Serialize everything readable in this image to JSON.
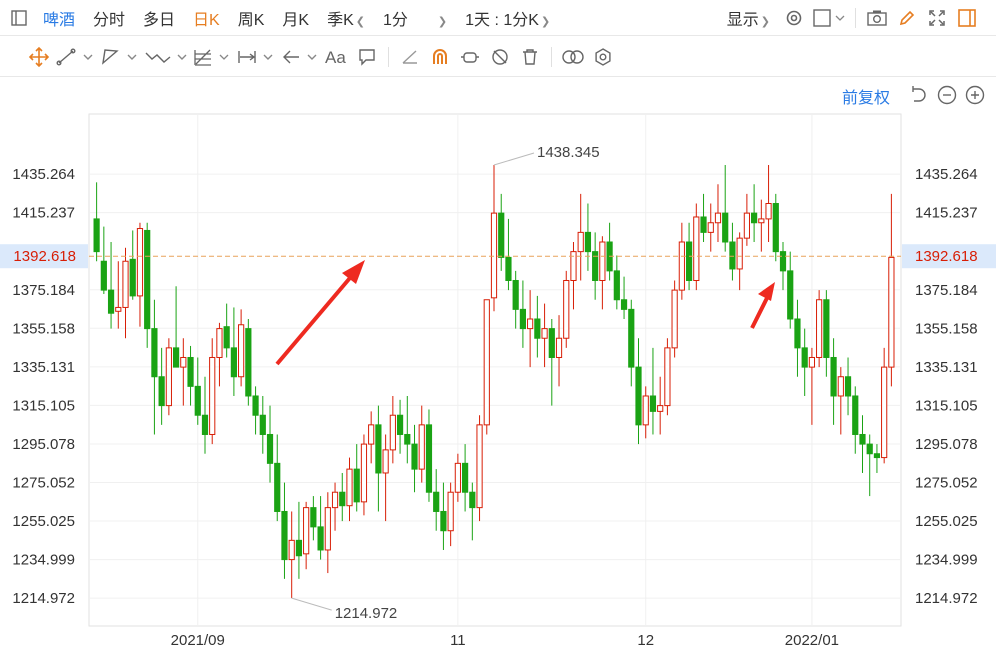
{
  "toolbar": {
    "symbol": "啤酒",
    "periods": [
      {
        "label": "分时",
        "active": false
      },
      {
        "label": "多日",
        "active": false
      },
      {
        "label": "日K",
        "active": true
      },
      {
        "label": "周K",
        "active": false
      },
      {
        "label": "月K",
        "active": false
      },
      {
        "label": "季K",
        "active": false
      }
    ],
    "minute_select": "1分",
    "range_select": "1天 : 1分K",
    "display_label": "显示"
  },
  "adjust_label": "前复权",
  "colors": {
    "up": "#d81e06",
    "down": "#1aa314",
    "current": "#e8a25a",
    "accent": "#2a7be4"
  },
  "chart_data": {
    "type": "candlestick",
    "current_price": "1392.618",
    "y_ticks": [
      "1435.264",
      "1415.237",
      "1375.184",
      "1355.158",
      "1335.131",
      "1315.105",
      "1295.078",
      "1275.052",
      "1255.025",
      "1234.999",
      "1214.972"
    ],
    "x_ticks": [
      "2021/09",
      "11",
      "12",
      "2022/01"
    ],
    "high_label": "1438.345",
    "low_label": "1214.972",
    "ylim": [
      1200.5,
      1466.5
    ],
    "candles": [
      [
        1412,
        1431,
        1390,
        1395
      ],
      [
        1390,
        1408,
        1373,
        1375
      ],
      [
        1375,
        1400,
        1355,
        1363
      ],
      [
        1364,
        1390,
        1355,
        1366
      ],
      [
        1366,
        1397,
        1350,
        1390
      ],
      [
        1391,
        1406,
        1370,
        1372
      ],
      [
        1372,
        1410,
        1356,
        1407
      ],
      [
        1406,
        1410,
        1345,
        1355
      ],
      [
        1355,
        1370,
        1300,
        1330
      ],
      [
        1330,
        1345,
        1305,
        1315
      ],
      [
        1315,
        1350,
        1310,
        1345
      ],
      [
        1345,
        1377,
        1335,
        1335
      ],
      [
        1335,
        1350,
        1315,
        1340
      ],
      [
        1340,
        1346,
        1315,
        1325
      ],
      [
        1325,
        1340,
        1305,
        1310
      ],
      [
        1310,
        1330,
        1290,
        1300
      ],
      [
        1300,
        1350,
        1295,
        1340
      ],
      [
        1340,
        1358,
        1325,
        1355
      ],
      [
        1356,
        1368,
        1340,
        1345
      ],
      [
        1345,
        1366,
        1320,
        1330
      ],
      [
        1330,
        1365,
        1325,
        1357
      ],
      [
        1355,
        1360,
        1315,
        1320
      ],
      [
        1320,
        1325,
        1300,
        1310
      ],
      [
        1310,
        1320,
        1290,
        1300
      ],
      [
        1300,
        1315,
        1275,
        1285
      ],
      [
        1285,
        1300,
        1255,
        1260
      ],
      [
        1260,
        1275,
        1225,
        1235
      ],
      [
        1235,
        1260,
        1215,
        1245
      ],
      [
        1245,
        1265,
        1225,
        1237
      ],
      [
        1238,
        1265,
        1230,
        1262
      ],
      [
        1262,
        1268,
        1245,
        1252
      ],
      [
        1252,
        1268,
        1235,
        1240
      ],
      [
        1240,
        1270,
        1228,
        1262
      ],
      [
        1262,
        1275,
        1250,
        1270
      ],
      [
        1270,
        1280,
        1255,
        1263
      ],
      [
        1263,
        1288,
        1255,
        1282
      ],
      [
        1282,
        1295,
        1260,
        1265
      ],
      [
        1265,
        1300,
        1258,
        1295
      ],
      [
        1295,
        1312,
        1285,
        1305
      ],
      [
        1305,
        1315,
        1260,
        1280
      ],
      [
        1280,
        1300,
        1255,
        1292
      ],
      [
        1292,
        1320,
        1285,
        1310
      ],
      [
        1310,
        1318,
        1290,
        1300
      ],
      [
        1300,
        1320,
        1285,
        1295
      ],
      [
        1295,
        1305,
        1270,
        1282
      ],
      [
        1282,
        1315,
        1275,
        1305
      ],
      [
        1305,
        1313,
        1265,
        1270
      ],
      [
        1270,
        1282,
        1250,
        1260
      ],
      [
        1260,
        1275,
        1240,
        1250
      ],
      [
        1250,
        1275,
        1242,
        1270
      ],
      [
        1270,
        1290,
        1265,
        1285
      ],
      [
        1285,
        1295,
        1260,
        1270
      ],
      [
        1270,
        1275,
        1245,
        1262
      ],
      [
        1262,
        1310,
        1255,
        1305
      ],
      [
        1305,
        1370,
        1300,
        1370
      ],
      [
        1371,
        1440,
        1364,
        1415
      ],
      [
        1415,
        1425,
        1385,
        1392
      ],
      [
        1392,
        1412,
        1375,
        1380
      ],
      [
        1380,
        1385,
        1355,
        1365
      ],
      [
        1365,
        1380,
        1345,
        1355
      ],
      [
        1355,
        1375,
        1335,
        1360
      ],
      [
        1360,
        1372,
        1340,
        1350
      ],
      [
        1350,
        1368,
        1335,
        1355
      ],
      [
        1355,
        1360,
        1315,
        1340
      ],
      [
        1340,
        1362,
        1325,
        1350
      ],
      [
        1350,
        1385,
        1345,
        1380
      ],
      [
        1380,
        1400,
        1365,
        1395
      ],
      [
        1395,
        1425,
        1380,
        1405
      ],
      [
        1405,
        1420,
        1385,
        1395
      ],
      [
        1395,
        1405,
        1370,
        1380
      ],
      [
        1380,
        1403,
        1365,
        1400
      ],
      [
        1400,
        1410,
        1380,
        1385
      ],
      [
        1385,
        1393,
        1365,
        1370
      ],
      [
        1370,
        1382,
        1360,
        1365
      ],
      [
        1365,
        1370,
        1325,
        1335
      ],
      [
        1335,
        1350,
        1295,
        1305
      ],
      [
        1305,
        1325,
        1298,
        1320
      ],
      [
        1320,
        1345,
        1300,
        1312
      ],
      [
        1312,
        1330,
        1300,
        1315
      ],
      [
        1315,
        1350,
        1310,
        1345
      ],
      [
        1345,
        1380,
        1340,
        1375
      ],
      [
        1375,
        1410,
        1370,
        1400
      ],
      [
        1400,
        1410,
        1375,
        1380
      ],
      [
        1380,
        1420,
        1375,
        1413
      ],
      [
        1413,
        1425,
        1400,
        1405
      ],
      [
        1405,
        1420,
        1395,
        1410
      ],
      [
        1410,
        1430,
        1400,
        1415
      ],
      [
        1415,
        1440,
        1395,
        1400
      ],
      [
        1400,
        1410,
        1380,
        1386
      ],
      [
        1386,
        1405,
        1375,
        1402
      ],
      [
        1402,
        1425,
        1398,
        1415
      ],
      [
        1415,
        1430,
        1400,
        1410
      ],
      [
        1410,
        1422,
        1395,
        1412
      ],
      [
        1412,
        1440,
        1400,
        1420
      ],
      [
        1420,
        1425,
        1390,
        1395
      ],
      [
        1395,
        1400,
        1375,
        1385
      ],
      [
        1385,
        1395,
        1355,
        1360
      ],
      [
        1360,
        1370,
        1330,
        1345
      ],
      [
        1345,
        1355,
        1320,
        1335
      ],
      [
        1335,
        1345,
        1305,
        1340
      ],
      [
        1340,
        1375,
        1335,
        1370
      ],
      [
        1370,
        1375,
        1330,
        1340
      ],
      [
        1340,
        1350,
        1305,
        1320
      ],
      [
        1320,
        1335,
        1300,
        1330
      ],
      [
        1330,
        1340,
        1310,
        1320
      ],
      [
        1320,
        1325,
        1290,
        1300
      ],
      [
        1300,
        1310,
        1280,
        1295
      ],
      [
        1295,
        1300,
        1268,
        1290
      ],
      [
        1290,
        1295,
        1280,
        1288
      ],
      [
        1288,
        1345,
        1285,
        1335
      ],
      [
        1335,
        1425,
        1325,
        1392
      ]
    ]
  }
}
